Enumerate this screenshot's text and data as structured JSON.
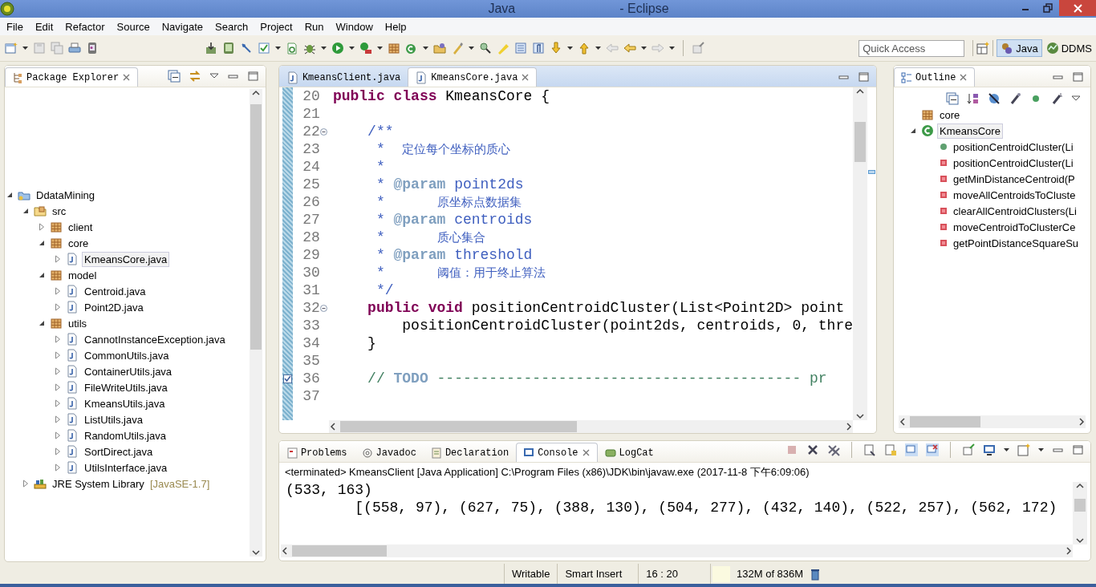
{
  "window": {
    "title_start": "Java",
    "title_end": "- Eclipse"
  },
  "menu": [
    "File",
    "Edit",
    "Refactor",
    "Source",
    "Navigate",
    "Search",
    "Project",
    "Run",
    "Window",
    "Help"
  ],
  "quick_access": {
    "placeholder": "Quick Access"
  },
  "perspectives": [
    {
      "label": "Java",
      "selected": true
    },
    {
      "label": "DDMS",
      "selected": false
    }
  ],
  "package_explorer": {
    "tab": "Package Explorer",
    "tree": [
      {
        "label": "DdataMining",
        "kind": "project",
        "expanded": true,
        "selected": false,
        "children": [
          {
            "label": "src",
            "kind": "source-folder",
            "expanded": true,
            "selected": false,
            "children": [
              {
                "label": "client",
                "kind": "package",
                "expanded": false,
                "selected": false
              },
              {
                "label": "core",
                "kind": "package",
                "expanded": true,
                "selected": false,
                "children": [
                  {
                    "label": "KmeansCore.java",
                    "kind": "java",
                    "expanded": false,
                    "selected": true
                  }
                ]
              },
              {
                "label": "model",
                "kind": "package",
                "expanded": true,
                "selected": false,
                "children": [
                  {
                    "label": "Centroid.java",
                    "kind": "java",
                    "expanded": false,
                    "selected": false
                  },
                  {
                    "label": "Point2D.java",
                    "kind": "java",
                    "expanded": false,
                    "selected": false
                  }
                ]
              },
              {
                "label": "utils",
                "kind": "package",
                "expanded": true,
                "selected": false,
                "children": [
                  {
                    "label": "CannotInstanceException.java",
                    "kind": "java",
                    "expanded": false,
                    "selected": false
                  },
                  {
                    "label": "CommonUtils.java",
                    "kind": "java",
                    "expanded": false,
                    "selected": false
                  },
                  {
                    "label": "ContainerUtils.java",
                    "kind": "java",
                    "expanded": false,
                    "selected": false
                  },
                  {
                    "label": "FileWriteUtils.java",
                    "kind": "java",
                    "expanded": false,
                    "selected": false
                  },
                  {
                    "label": "KmeansUtils.java",
                    "kind": "java",
                    "expanded": false,
                    "selected": false
                  },
                  {
                    "label": "ListUtils.java",
                    "kind": "java",
                    "expanded": false,
                    "selected": false
                  },
                  {
                    "label": "RandomUtils.java",
                    "kind": "java",
                    "expanded": false,
                    "selected": false
                  },
                  {
                    "label": "SortDirect.java",
                    "kind": "java",
                    "expanded": false,
                    "selected": false
                  },
                  {
                    "label": "UtilsInterface.java",
                    "kind": "java",
                    "expanded": false,
                    "selected": false
                  }
                ]
              }
            ]
          },
          {
            "label": "JRE System Library",
            "qualifier": "[JavaSE-1.7]",
            "kind": "library",
            "expanded": false,
            "selected": false
          }
        ]
      }
    ]
  },
  "editor": {
    "tabs": [
      {
        "label": "KmeansClient.java",
        "selected": false
      },
      {
        "label": "KmeansCore.java",
        "selected": true
      }
    ],
    "lines": [
      {
        "number": "20",
        "fold": false,
        "task": false,
        "segments": [
          {
            "kind": "keyword",
            "text": "public class"
          },
          {
            "kind": "plain",
            "text": " KmeansCore {"
          }
        ]
      },
      {
        "number": "21",
        "fold": false,
        "task": false
      },
      {
        "number": "22",
        "fold": true,
        "task": false,
        "segments": [
          {
            "kind": "comment",
            "text": "    /**"
          }
        ]
      },
      {
        "number": "23",
        "fold": false,
        "task": false,
        "segments": [
          {
            "kind": "comment",
            "text": "     *  "
          },
          {
            "kind": "cjk",
            "text": "定位每个坐标的质心"
          }
        ]
      },
      {
        "number": "24",
        "fold": false,
        "task": false,
        "segments": [
          {
            "kind": "comment",
            "text": "     *"
          }
        ]
      },
      {
        "number": "25",
        "fold": false,
        "task": false,
        "segments": [
          {
            "kind": "comment",
            "text": "     * "
          },
          {
            "kind": "doctag",
            "text": "@param"
          },
          {
            "kind": "comment",
            "text": " point2ds"
          }
        ]
      },
      {
        "number": "26",
        "fold": false,
        "task": false,
        "segments": [
          {
            "kind": "comment",
            "text": "     *      "
          },
          {
            "kind": "cjk",
            "text": "原坐标点数据集"
          }
        ]
      },
      {
        "number": "27",
        "fold": false,
        "task": false,
        "segments": [
          {
            "kind": "comment",
            "text": "     * "
          },
          {
            "kind": "doctag",
            "text": "@param"
          },
          {
            "kind": "comment",
            "text": " centroids"
          }
        ]
      },
      {
        "number": "28",
        "fold": false,
        "task": false,
        "segments": [
          {
            "kind": "comment",
            "text": "     *      "
          },
          {
            "kind": "cjk",
            "text": "质心集合"
          }
        ]
      },
      {
        "number": "29",
        "fold": false,
        "task": false,
        "segments": [
          {
            "kind": "comment",
            "text": "     * "
          },
          {
            "kind": "doctag",
            "text": "@param"
          },
          {
            "kind": "comment",
            "text": " threshold"
          }
        ]
      },
      {
        "number": "30",
        "fold": false,
        "task": false,
        "segments": [
          {
            "kind": "comment",
            "text": "     *      "
          },
          {
            "kind": "cjk",
            "text": "阈值：用于终止算法"
          }
        ]
      },
      {
        "number": "31",
        "fold": false,
        "task": false,
        "segments": [
          {
            "kind": "comment",
            "text": "     */"
          }
        ]
      },
      {
        "number": "32",
        "fold": true,
        "task": false,
        "segments": [
          {
            "kind": "keyword",
            "text": "    public void"
          },
          {
            "kind": "plain",
            "text": " positionCentroidCluster(List<Point2D> point"
          }
        ]
      },
      {
        "number": "33",
        "fold": false,
        "task": false,
        "segments": [
          {
            "kind": "plain",
            "text": "        positionCentroidCluster(point2ds, centroids, 0, thre"
          }
        ]
      },
      {
        "number": "34",
        "fold": false,
        "task": false,
        "segments": [
          {
            "kind": "plain",
            "text": "    }"
          }
        ]
      },
      {
        "number": "35",
        "fold": false,
        "task": false
      },
      {
        "number": "36",
        "fold": false,
        "task": true,
        "segments": [
          {
            "kind": "linecomment",
            "text": "    // "
          },
          {
            "kind": "task",
            "text": "TODO"
          },
          {
            "kind": "linecomment",
            "text": " ------------------------------------------ pr"
          }
        ]
      },
      {
        "number": "37",
        "fold": false,
        "task": false
      }
    ]
  },
  "outline": {
    "tab": "Outline",
    "items": [
      {
        "label": "core",
        "kind": "package",
        "selected": false
      },
      {
        "label": "KmeansCore",
        "kind": "class",
        "expanded": true,
        "selected": true,
        "children": [
          {
            "label": "positionCentroidCluster(Li",
            "kind": "public",
            "selected": false
          },
          {
            "label": "positionCentroidCluster(Li",
            "kind": "private",
            "selected": false
          },
          {
            "label": "getMinDistanceCentroid(P",
            "kind": "private",
            "selected": false
          },
          {
            "label": "moveAllCentroidsToCluste",
            "kind": "private",
            "selected": false
          },
          {
            "label": "clearAllCentroidClusters(Li",
            "kind": "private",
            "selected": false
          },
          {
            "label": "moveCentroidToClusterCe",
            "kind": "private",
            "selected": false
          },
          {
            "label": "getPointDistanceSquareSu",
            "kind": "private",
            "selected": false
          }
        ]
      }
    ]
  },
  "console": {
    "tabs": [
      {
        "label": "Problems",
        "selected": false
      },
      {
        "label": "Javadoc",
        "selected": false
      },
      {
        "label": "Declaration",
        "selected": false
      },
      {
        "label": "Console",
        "selected": true
      },
      {
        "label": "LogCat",
        "selected": false
      }
    ],
    "header": "<terminated> KmeansClient [Java Application] C:\\Program Files (x86)\\JDK\\bin\\javaw.exe (2017-11-8 下午6:09:06)",
    "output": [
      "(533, 163)",
      "        [(558, 97), (627, 75), (388, 130), (504, 277), (432, 140), (522, 257), (562, 172)"
    ]
  },
  "status_bar": {
    "mode": "Writable",
    "insert": "Smart Insert",
    "position": "16 : 20",
    "memory": "132M of 836M"
  }
}
